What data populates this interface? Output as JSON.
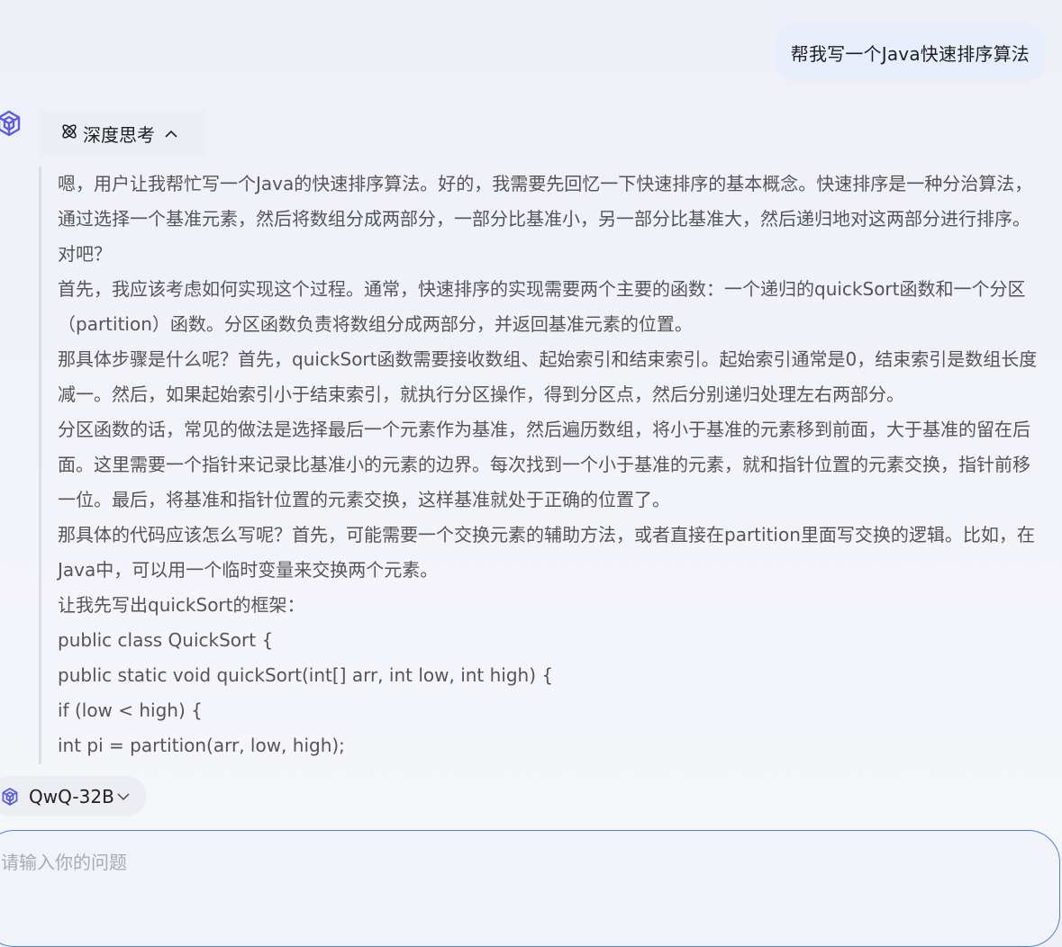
{
  "user_message": "帮我写一个Java快速排序算法",
  "thinking": {
    "label": "深度思考",
    "paragraphs": [
      "嗯，用户让我帮忙写一个Java的快速排序算法。好的，我需要先回忆一下快速排序的基本概念。快速排序是一种分治算法，通过选择一个基准元素，然后将数组分成两部分，一部分比基准小，另一部分比基准大，然后递归地对这两部分进行排序。对吧？",
      "首先，我应该考虑如何实现这个过程。通常，快速排序的实现需要两个主要的函数：一个递归的quickSort函数和一个分区（partition）函数。分区函数负责将数组分成两部分，并返回基准元素的位置。",
      "那具体步骤是什么呢？首先，quickSort函数需要接收数组、起始索引和结束索引。起始索引通常是0，结束索引是数组长度减一。然后，如果起始索引小于结束索引，就执行分区操作，得到分区点，然后分别递归处理左右两部分。",
      "分区函数的话，常见的做法是选择最后一个元素作为基准，然后遍历数组，将小于基准的元素移到前面，大于基准的留在后面。这里需要一个指针来记录比基准小的元素的边界。每次找到一个小于基准的元素，就和指针位置的元素交换，指针前移一位。最后，将基准和指针位置的元素交换，这样基准就处于正确的位置了。",
      "那具体的代码应该怎么写呢？首先，可能需要一个交换元素的辅助方法，或者直接在partition里面写交换的逻辑。比如，在Java中，可以用一个临时变量来交换两个元素。",
      "让我先写出quickSort的框架：",
      "public class QuickSort {",
      "public static void quickSort(int[] arr, int low, int high) {",
      "if (low < high) {",
      "int pi = partition(arr, low, high);"
    ]
  },
  "model": {
    "name": "QwQ-32B"
  },
  "input": {
    "placeholder": "请输入你的问题"
  }
}
